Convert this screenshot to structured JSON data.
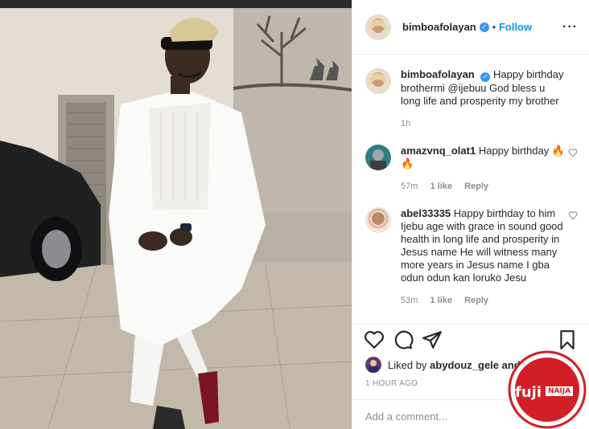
{
  "post": {
    "username": "bimboafolayan",
    "follow_label": "Follow",
    "separator": "•",
    "more_icon": "···",
    "caption": {
      "username": "bimboafolayan",
      "text": "Happy birthday brothermi @ijebuu God bless u long life and prosperity my brother",
      "time": "1h"
    },
    "comments": [
      {
        "username": "amazvnq_olat1",
        "text": "Happy birthday 🔥🔥",
        "time": "57m",
        "likes": "1 like",
        "reply": "Reply"
      },
      {
        "username": "abel33335",
        "text": "Happy birthday to him Ijebu age with grace in sound good health in long life and prosperity in Jesus name He will witness many more years in Jesus name I gba odun odun kan loruko Jesu",
        "time": "53m",
        "likes": "1 like",
        "reply": "Reply"
      }
    ],
    "liked_by_prefix": "Liked by",
    "liked_by_user": "abydouz_gele",
    "liked_by_suffix": "and 58",
    "post_time": "1 HOUR AGO",
    "add_comment_placeholder": "Add a comment..."
  },
  "watermark": {
    "brand": "fuji",
    "badge": "NAIJA"
  },
  "colors": {
    "accent": "#0095f6",
    "verified": "#3897f0",
    "watermark_red": "#d21f26"
  }
}
